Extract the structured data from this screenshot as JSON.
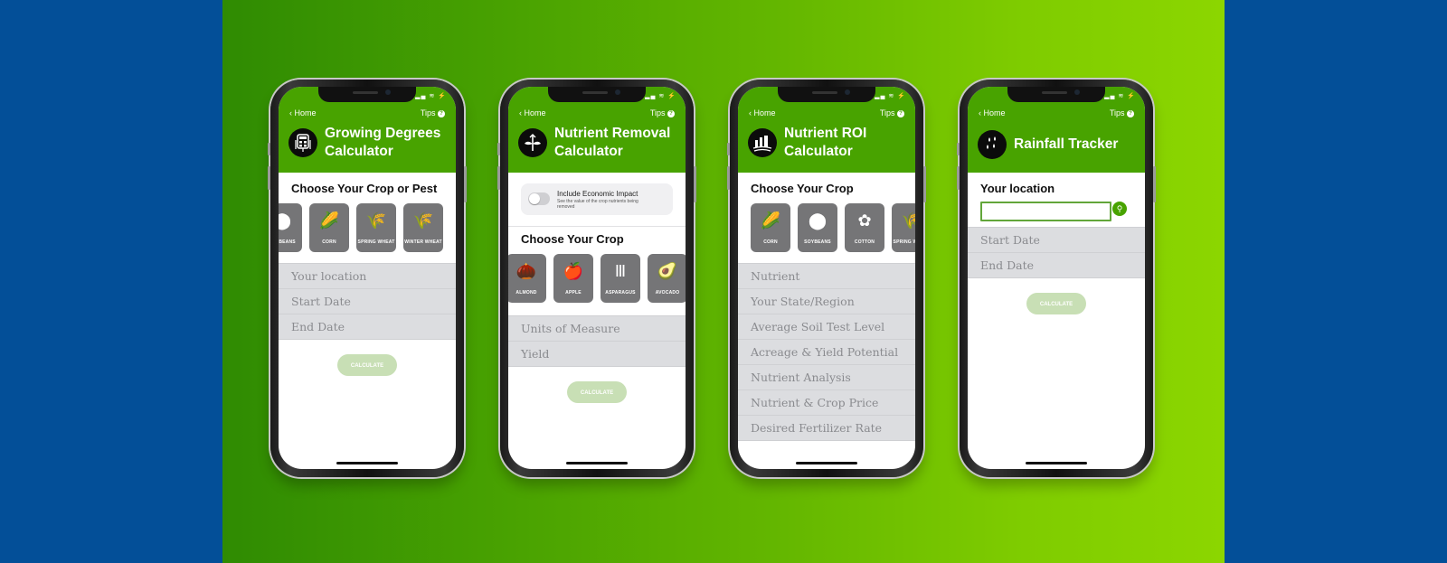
{
  "colors": {
    "background_blue": "#034f98",
    "header_green": "#48a300",
    "field_gray": "#dcdde0",
    "tile_gray": "#757577",
    "calculate_disabled": "#c8dfb5"
  },
  "phones": [
    {
      "status": "▂▄ ≋ ⚡",
      "back_label": "Home",
      "back_icon": "chevron-left-icon",
      "tips_label": "Tips",
      "tips_icon": "question-circle-icon",
      "logo_icon": "calculator-icon",
      "title": "Growing Degrees Calculator",
      "section_title": "Choose Your Crop or Pest",
      "crops": [
        {
          "label": "SOYBEANS",
          "icon": "soybeans-icon"
        },
        {
          "label": "CORN",
          "icon": "corn-icon"
        },
        {
          "label": "SPRING WHEAT",
          "icon": "wheat-icon"
        },
        {
          "label": "WINTER WHEAT",
          "icon": "wheat-icon"
        }
      ],
      "fields": [
        "Your location",
        "Start Date",
        "End Date"
      ],
      "calculate_label": "CALCULATE"
    },
    {
      "status": "▂▄ ≋ ⚡",
      "back_label": "Home",
      "tips_label": "Tips",
      "logo_icon": "plant-icon",
      "title": "Nutrient Removal Calculator",
      "toggle": {
        "label": "Include Economic Impact",
        "sublabel": "See the value of the crop nutrients being removed",
        "on": false
      },
      "section_title": "Choose Your Crop",
      "crops": [
        {
          "label": "ALMOND",
          "icon": "almond-icon"
        },
        {
          "label": "APPLE",
          "icon": "apple-icon"
        },
        {
          "label": "ASPARAGUS",
          "icon": "asparagus-icon"
        },
        {
          "label": "AVOCADO",
          "icon": "avocado-icon"
        }
      ],
      "fields": [
        "Units of Measure",
        "Yield"
      ],
      "calculate_label": "CALCULATE"
    },
    {
      "status": "▂▄ ≋ ⚡",
      "back_label": "Home",
      "tips_label": "Tips",
      "logo_icon": "silo-icon",
      "title": "Nutrient ROI Calculator",
      "section_title": "Choose Your Crop",
      "crops": [
        {
          "label": "CORN",
          "icon": "corn-icon"
        },
        {
          "label": "SOYBEANS",
          "icon": "soybeans-icon"
        },
        {
          "label": "COTTON",
          "icon": "cotton-icon"
        },
        {
          "label": "SPRING WHEAT",
          "icon": "wheat-icon"
        }
      ],
      "fields": [
        "Nutrient",
        "Your State/Region",
        "Average Soil Test Level",
        "Acreage & Yield Potential",
        "Nutrient Analysis",
        "Nutrient & Crop Price",
        "Desired Fertilizer Rate"
      ]
    },
    {
      "status": "▂▄ ≋ ⚡",
      "back_label": "Home",
      "tips_label": "Tips",
      "logo_icon": "raindrops-icon",
      "title": "Rainfall Tracker",
      "location_label": "Your location",
      "location_value": "",
      "location_button_icon": "location-pin-icon",
      "fields": [
        "Start Date",
        "End Date"
      ],
      "calculate_label": "CALCULATE"
    }
  ]
}
